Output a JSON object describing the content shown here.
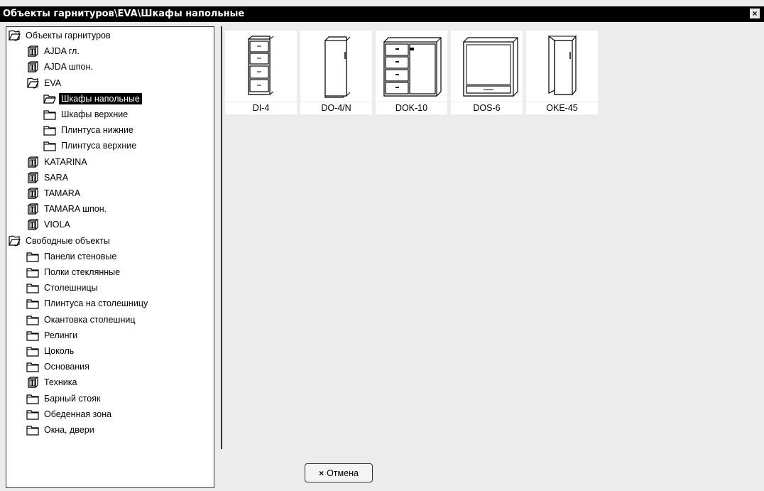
{
  "window": {
    "title": "Объекты гарнитуров\\EVA\\Шкафы напольные",
    "close_glyph": "×"
  },
  "tree": [
    {
      "label": "Объекты гарнитуров",
      "icon": "open-catalog-icon"
    },
    {
      "label": "AJDA гл.",
      "icon": "cabinet-group-icon"
    },
    {
      "label": "AJDA шпон.",
      "icon": "cabinet-group-icon"
    },
    {
      "label": "EVA",
      "icon": "open-catalog-icon"
    },
    {
      "label": "Шкафы напольные",
      "icon": "open-folder-icon",
      "selected": true
    },
    {
      "label": "Шкафы верхние",
      "icon": "folder-icon"
    },
    {
      "label": "Плинтуса нижние",
      "icon": "folder-icon"
    },
    {
      "label": "Плинтуса верхние",
      "icon": "folder-icon"
    },
    {
      "label": "KATARINA",
      "icon": "cabinet-group-icon"
    },
    {
      "label": "SARA",
      "icon": "cabinet-group-icon"
    },
    {
      "label": "TAMARA",
      "icon": "cabinet-group-icon"
    },
    {
      "label": "TAMARA шпон.",
      "icon": "cabinet-group-icon"
    },
    {
      "label": "VIOLA",
      "icon": "cabinet-group-icon"
    },
    {
      "label": "Свободные объекты",
      "icon": "open-catalog-icon"
    },
    {
      "label": "Панели стеновые",
      "icon": "folder-icon"
    },
    {
      "label": "Полки стеклянные",
      "icon": "folder-icon"
    },
    {
      "label": "Столешницы",
      "icon": "folder-icon"
    },
    {
      "label": "Плинтуса на столешницу",
      "icon": "folder-icon"
    },
    {
      "label": "Окантовка столешниц",
      "icon": "folder-icon"
    },
    {
      "label": "Релинги",
      "icon": "folder-icon"
    },
    {
      "label": "Цоколь",
      "icon": "folder-icon"
    },
    {
      "label": "Основания",
      "icon": "folder-icon"
    },
    {
      "label": "Техника",
      "icon": "cabinet-group-icon"
    },
    {
      "label": "Барный стояк",
      "icon": "folder-icon"
    },
    {
      "label": "Обеденная зона",
      "icon": "folder-icon"
    },
    {
      "label": "Окна, двери",
      "icon": "folder-icon"
    }
  ],
  "items": [
    {
      "label": "DI-4",
      "icon": "drawer-cabinet-icon"
    },
    {
      "label": "DO-4/N",
      "icon": "door-cabinet-icon"
    },
    {
      "label": "DOK-10",
      "icon": "drawer-door-cabinet-icon"
    },
    {
      "label": "DOS-6",
      "icon": "open-shelf-cabinet-icon"
    },
    {
      "label": "OKE-45",
      "icon": "corner-cabinet-icon"
    }
  ],
  "buttons": {
    "cancel": "Отмена",
    "cancel_glyph": "×"
  }
}
